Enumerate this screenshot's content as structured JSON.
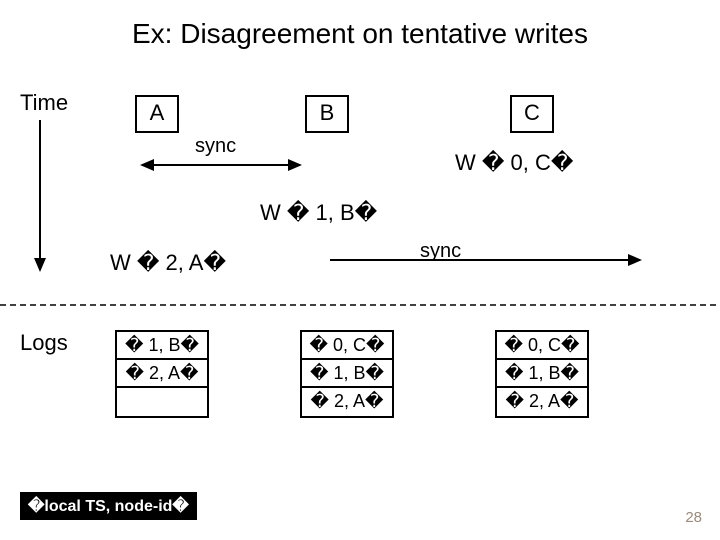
{
  "title": "Ex: Disagreement on tentative writes",
  "timeLabel": "Time",
  "nodes": {
    "a": "A",
    "b": "B",
    "c": "C"
  },
  "syncLabelAB": "sync",
  "syncLabelBC": "sync",
  "writes": {
    "w0c": "W � 0, C�",
    "w1b": "W � 1, B�",
    "w2a": "W � 2, A�"
  },
  "logsLabel": "Logs",
  "logA": [
    "� 1, B�",
    "� 2, A�",
    ""
  ],
  "logB": [
    "� 0, C�",
    "� 1, B�",
    "� 2, A�"
  ],
  "logC": [
    "� 0, C�",
    "� 1, B�",
    "� 2, A�"
  ],
  "legend": "�local TS, node-id�",
  "pageNumber": "28"
}
